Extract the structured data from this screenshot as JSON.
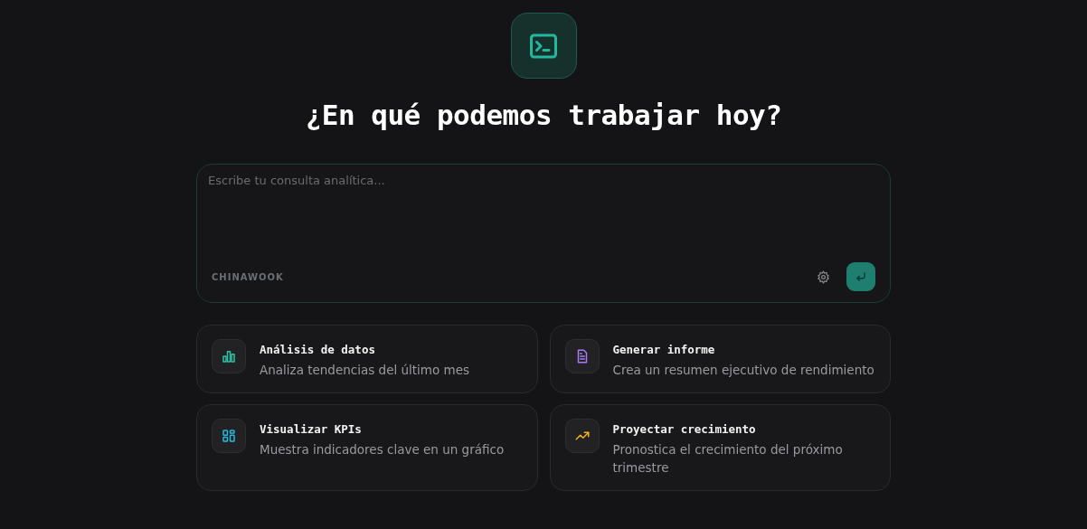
{
  "heading": "¿En qué podemos trabajar hoy?",
  "composer": {
    "placeholder": "Escribe tu consulta analítica...",
    "brand": "CHINAWOOK"
  },
  "suggestions": [
    {
      "kind": "bars",
      "color": "#2bc4a5",
      "title": "Análisis de datos",
      "description": "Analiza tendencias del último mes"
    },
    {
      "kind": "document",
      "color": "#a77cf5",
      "title": "Generar informe",
      "description": "Crea un resumen ejecutivo de rendimiento"
    },
    {
      "kind": "grid",
      "color": "#27b9dc",
      "title": "Visualizar KPIs",
      "description": "Muestra indicadores clave en un gráfico"
    },
    {
      "kind": "trend",
      "color": "#f2b01e",
      "title": "Proyectar crecimiento",
      "description": "Pronostica el crecimiento del próximo trimestre"
    }
  ]
}
